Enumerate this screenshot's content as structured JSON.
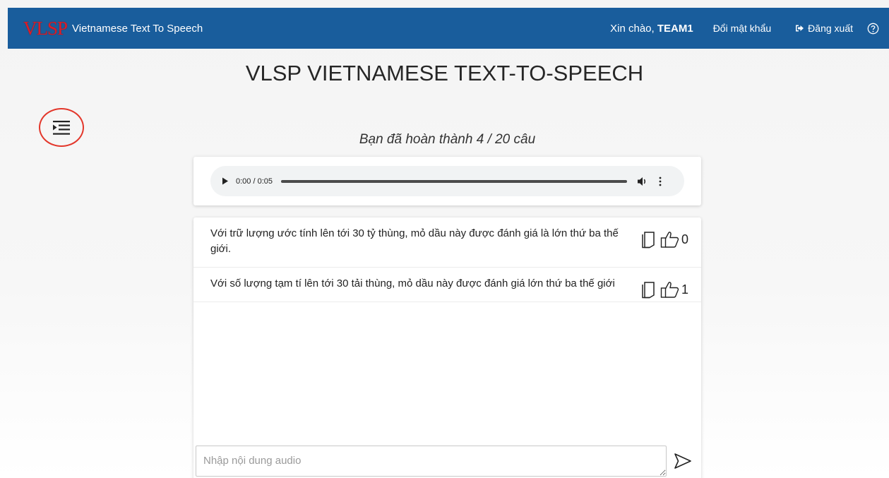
{
  "header": {
    "logo_text": "VLSP",
    "app_title": "Vietnamese Text To Speech",
    "greeting_prefix": "Xin chào,",
    "username": "TEAM1",
    "change_password_label": "Đổi mật khẩu",
    "logout_label": "Đăng xuất",
    "help_icon": "help-circle-icon",
    "background_color": "#195d9c",
    "logo_color": "#d81e2a"
  },
  "page": {
    "title": "VLSP VIETNAMESE TEXT-TO-SPEECH",
    "progress_text": "Bạn đã hoàn thành 4 / 20 câu",
    "progress": {
      "completed": 4,
      "total": 20
    }
  },
  "sidebar_toggle": {
    "icon": "indent-icon",
    "highlight_color": "#e3372b"
  },
  "audio": {
    "current_time": "0:00",
    "duration": "0:05",
    "time_display": "0:00 / 0:05"
  },
  "sentences": [
    {
      "text": "Với trữ lượng ước tính lên tới 30 tỷ thùng, mỏ dầu này được đánh giá là lớn thứ ba thế giới.",
      "likes": "0"
    },
    {
      "text": "Với số lượng tạm tí lên tới 30 tải thùng, mỏ dầu này được đánh giá lớn thứ ba thế giới",
      "likes": "1"
    }
  ],
  "input": {
    "placeholder": "Nhập nội dung audio",
    "value": ""
  },
  "send_icon": "send-icon"
}
